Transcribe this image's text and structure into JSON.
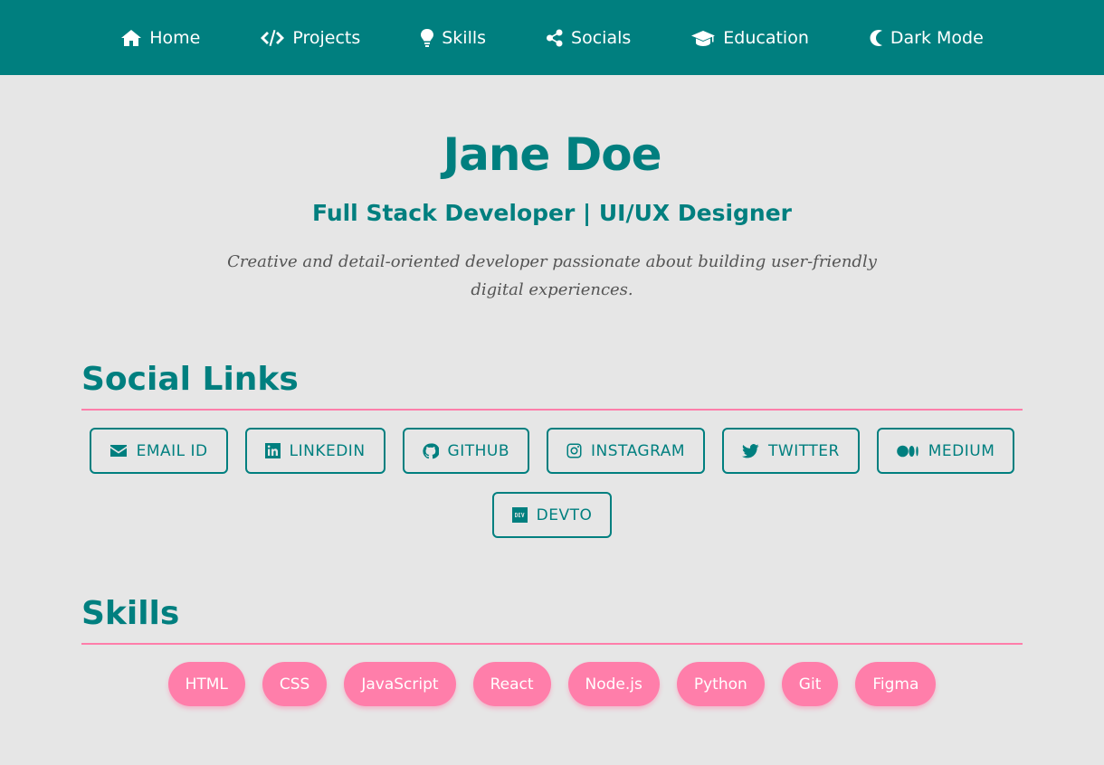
{
  "nav": {
    "items": [
      {
        "label": "Home",
        "icon": "home-icon"
      },
      {
        "label": "Projects",
        "icon": "code-icon"
      },
      {
        "label": "Skills",
        "icon": "lightbulb-icon"
      },
      {
        "label": "Socials",
        "icon": "share-icon"
      },
      {
        "label": "Education",
        "icon": "graduation-cap-icon"
      },
      {
        "label": "Dark Mode",
        "icon": "moon-icon"
      }
    ]
  },
  "hero": {
    "name": "Jane Doe",
    "tagline": "Full Stack Developer | UI/UX Designer",
    "description": "Creative and detail-oriented developer passionate about building user-friendly digital experiences."
  },
  "social": {
    "title": "Social Links",
    "links": [
      {
        "label": "EMAIL ID",
        "icon": "envelope-icon"
      },
      {
        "label": "LINKEDIN",
        "icon": "linkedin-icon"
      },
      {
        "label": "GITHUB",
        "icon": "github-icon"
      },
      {
        "label": "INSTAGRAM",
        "icon": "instagram-icon"
      },
      {
        "label": "TWITTER",
        "icon": "twitter-icon"
      },
      {
        "label": "MEDIUM",
        "icon": "medium-icon"
      },
      {
        "label": "DEVTO",
        "icon": "devto-icon"
      }
    ]
  },
  "skills": {
    "title": "Skills",
    "items": [
      "HTML",
      "CSS",
      "JavaScript",
      "React",
      "Node.js",
      "Python",
      "Git",
      "Figma"
    ]
  },
  "colors": {
    "primary": "#007f7f",
    "accent": "#ff7eaa",
    "background": "#e6e6e6"
  }
}
